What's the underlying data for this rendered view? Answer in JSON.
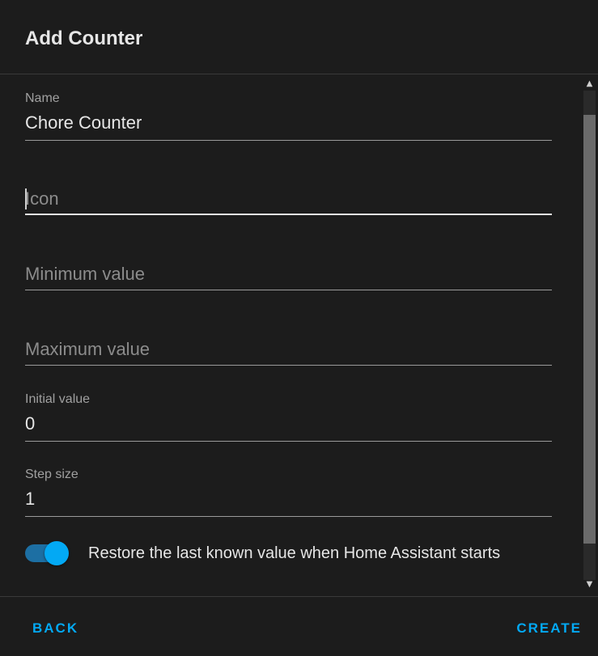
{
  "dialog": {
    "title": "Add Counter"
  },
  "form": {
    "name": {
      "label": "Name",
      "value": "Chore Counter"
    },
    "icon": {
      "placeholder": "Icon"
    },
    "minimum": {
      "placeholder": "Minimum value"
    },
    "maximum": {
      "placeholder": "Maximum value"
    },
    "initial": {
      "label": "Initial value",
      "value": "0"
    },
    "step": {
      "label": "Step size",
      "value": "1"
    },
    "restore": {
      "label": "Restore the last known value when Home Assistant starts",
      "checked": true
    }
  },
  "footer": {
    "back_label": "BACK",
    "create_label": "CREATE"
  },
  "colors": {
    "accent": "#03a9f4",
    "background": "#1c1c1c"
  },
  "icons": {
    "scroll_up": "scroll-up-arrow-icon",
    "scroll_down": "scroll-down-arrow-icon"
  }
}
